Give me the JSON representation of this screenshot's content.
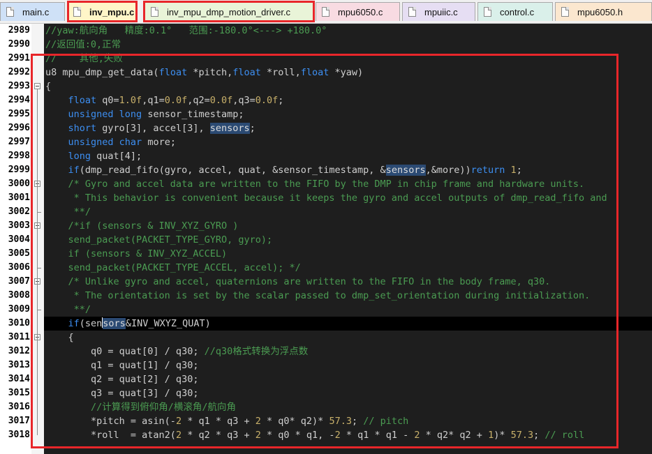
{
  "tabs": [
    {
      "label": "main.c",
      "bg": "#cfe1f7",
      "active": false
    },
    {
      "label": "inv_mpu.c",
      "bg": "#fff6c8",
      "active": true
    },
    {
      "label": "inv_mpu_dmp_motion_driver.c",
      "bg": "#e9f4d8",
      "active": false
    },
    {
      "label": "mpu6050.c",
      "bg": "#f8dbe2",
      "active": false
    },
    {
      "label": "mpuiic.c",
      "bg": "#e6def3",
      "active": false
    },
    {
      "label": "control.c",
      "bg": "#daf0ea",
      "active": false
    },
    {
      "label": "mpu6050.h",
      "bg": "#fbe7cf",
      "active": false
    }
  ],
  "colors": {
    "keyword": "#3d8ff2",
    "comment": "#4b9c52",
    "number": "#c8b06a",
    "highlight_box": "#e8262a",
    "editor_bg": "#1e1e1e"
  },
  "editor": {
    "line_numbers": [
      "2989",
      "2990",
      "2991",
      "2992",
      "2993",
      "2994",
      "2995",
      "2996",
      "2997",
      "2998",
      "2999",
      "3000",
      "3001",
      "3002",
      "3003",
      "3004",
      "3005",
      "3006",
      "3007",
      "3008",
      "3009",
      "3010",
      "3011",
      "3012",
      "3013",
      "3014",
      "3015",
      "3016",
      "3017",
      "3018"
    ],
    "lines": [
      [
        [
          "c",
          "//yaw:航向角   精度:0.1°   范围:-180.0°<---> +180.0°"
        ]
      ],
      [
        [
          "c",
          "//返回值:0,正常"
        ]
      ],
      [
        [
          "c",
          "//    其他,失败"
        ]
      ],
      [
        [
          "n",
          "u8 mpu_dmp_get_data("
        ],
        [
          "k",
          "float"
        ],
        [
          "n",
          " *pitch,"
        ],
        [
          "k",
          "float"
        ],
        [
          "n",
          " *roll,"
        ],
        [
          "k",
          "float"
        ],
        [
          "n",
          " *yaw)"
        ]
      ],
      [
        [
          "n",
          "{"
        ]
      ],
      [
        [
          "n",
          "    "
        ],
        [
          "k",
          "float"
        ],
        [
          "n",
          " q0="
        ],
        [
          "num",
          "1.0f"
        ],
        [
          "n",
          ",q1="
        ],
        [
          "num",
          "0.0f"
        ],
        [
          "n",
          ",q2="
        ],
        [
          "num",
          "0.0f"
        ],
        [
          "n",
          ",q3="
        ],
        [
          "num",
          "0.0f"
        ],
        [
          "n",
          ";"
        ]
      ],
      [
        [
          "n",
          "    "
        ],
        [
          "k",
          "unsigned long"
        ],
        [
          "n",
          " sensor_timestamp;"
        ]
      ],
      [
        [
          "n",
          "    "
        ],
        [
          "k",
          "short"
        ],
        [
          "n",
          " gyro[3], accel[3], "
        ],
        [
          "sel",
          "sensors"
        ],
        [
          "n",
          ";"
        ]
      ],
      [
        [
          "n",
          "    "
        ],
        [
          "k",
          "unsigned char"
        ],
        [
          "n",
          " more;"
        ]
      ],
      [
        [
          "n",
          "    "
        ],
        [
          "k",
          "long"
        ],
        [
          "n",
          " quat[4];"
        ]
      ],
      [
        [
          "n",
          "    "
        ],
        [
          "k",
          "if"
        ],
        [
          "n",
          "(dmp_read_fifo(gyro, accel, quat, &sensor_timestamp, &"
        ],
        [
          "sel",
          "sensors"
        ],
        [
          "n",
          ",&more))"
        ],
        [
          "k",
          "return"
        ],
        [
          "n",
          " "
        ],
        [
          "num",
          "1"
        ],
        [
          "n",
          ";"
        ]
      ],
      [
        [
          "c",
          "    /* Gyro and accel data are written to the FIFO by the DMP in chip frame and hardware units."
        ]
      ],
      [
        [
          "c",
          "     * This behavior is convenient because it keeps the gyro and accel outputs of dmp_read_fifo and"
        ]
      ],
      [
        [
          "c",
          "     **/"
        ]
      ],
      [
        [
          "c",
          "    /*if (sensors & INV_XYZ_GYRO )"
        ]
      ],
      [
        [
          "c",
          "    send_packet(PACKET_TYPE_GYRO, gyro);"
        ]
      ],
      [
        [
          "c",
          "    if (sensors & INV_XYZ_ACCEL)"
        ]
      ],
      [
        [
          "c",
          "    send_packet(PACKET_TYPE_ACCEL, accel); */"
        ]
      ],
      [
        [
          "c",
          "    /* Unlike gyro and accel, quaternions are written to the FIFO in the body frame, q30."
        ]
      ],
      [
        [
          "c",
          "     * The orientation is set by the scalar passed to dmp_set_orientation during initialization."
        ]
      ],
      [
        [
          "c",
          "     **/"
        ]
      ],
      [
        [
          "n",
          "    "
        ],
        [
          "k",
          "if"
        ],
        [
          "n",
          "(sen"
        ],
        [
          "caret",
          ""
        ],
        [
          "sel",
          "sors"
        ],
        [
          "n",
          "&INV_WXYZ_QUAT)"
        ]
      ],
      [
        [
          "n",
          "    {"
        ]
      ],
      [
        [
          "n",
          "        q0 = quat[0] / q30; "
        ],
        [
          "c",
          "//q30格式转换为浮点数"
        ]
      ],
      [
        [
          "n",
          "        q1 = quat[1] / q30;"
        ]
      ],
      [
        [
          "n",
          "        q2 = quat[2] / q30;"
        ]
      ],
      [
        [
          "n",
          "        q3 = quat[3] / q30;"
        ]
      ],
      [
        [
          "c",
          "        //计算得到俯仰角/横滚角/航向角"
        ]
      ],
      [
        [
          "n",
          "        *pitch = asin(-"
        ],
        [
          "num",
          "2"
        ],
        [
          "n",
          " * q1 * q3 + "
        ],
        [
          "num",
          "2"
        ],
        [
          "n",
          " * q0* q2)* "
        ],
        [
          "num",
          "57.3"
        ],
        [
          "n",
          "; "
        ],
        [
          "c",
          "// pitch"
        ]
      ],
      [
        [
          "n",
          "        *roll  = atan2("
        ],
        [
          "num",
          "2"
        ],
        [
          "n",
          " * q2 * q3 + "
        ],
        [
          "num",
          "2"
        ],
        [
          "n",
          " * q0 * q1, -"
        ],
        [
          "num",
          "2"
        ],
        [
          "n",
          " * q1 * q1 - "
        ],
        [
          "num",
          "2"
        ],
        [
          "n",
          " * q2* q2 + "
        ],
        [
          "num",
          "1"
        ],
        [
          "n",
          ")* "
        ],
        [
          "num",
          "57.3"
        ],
        [
          "n",
          "; "
        ],
        [
          "c",
          "// roll"
        ]
      ]
    ]
  }
}
